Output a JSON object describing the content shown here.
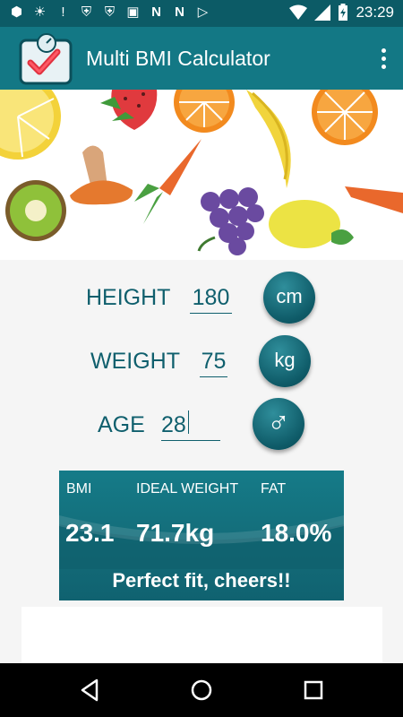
{
  "status_bar": {
    "time": "23:29",
    "icons": [
      "notification-icon",
      "lightbulb-icon",
      "exclamation-icon",
      "shield-icon",
      "shield-icon",
      "image-icon",
      "n-icon",
      "n-icon",
      "play-store-icon"
    ]
  },
  "toolbar": {
    "title": "Multi BMI Calculator"
  },
  "inputs": {
    "height_label": "HEIGHT",
    "height_value": "180",
    "height_unit": "cm",
    "weight_label": "WEIGHT",
    "weight_value": "75",
    "weight_unit": "kg",
    "age_label": "AGE",
    "age_value": "28",
    "gender_symbol": "♂"
  },
  "results": {
    "bmi_label": "BMI",
    "ideal_weight_label": "IDEAL WEIGHT",
    "fat_label": "FAT",
    "bmi_value": "23.1",
    "ideal_weight_value": "71.7kg",
    "fat_value": "18.0%",
    "message": "Perfect fit, cheers!!"
  },
  "colors": {
    "primary_dark": "#0c5b66",
    "primary": "#137885",
    "text_teal": "#0f5f6d"
  }
}
